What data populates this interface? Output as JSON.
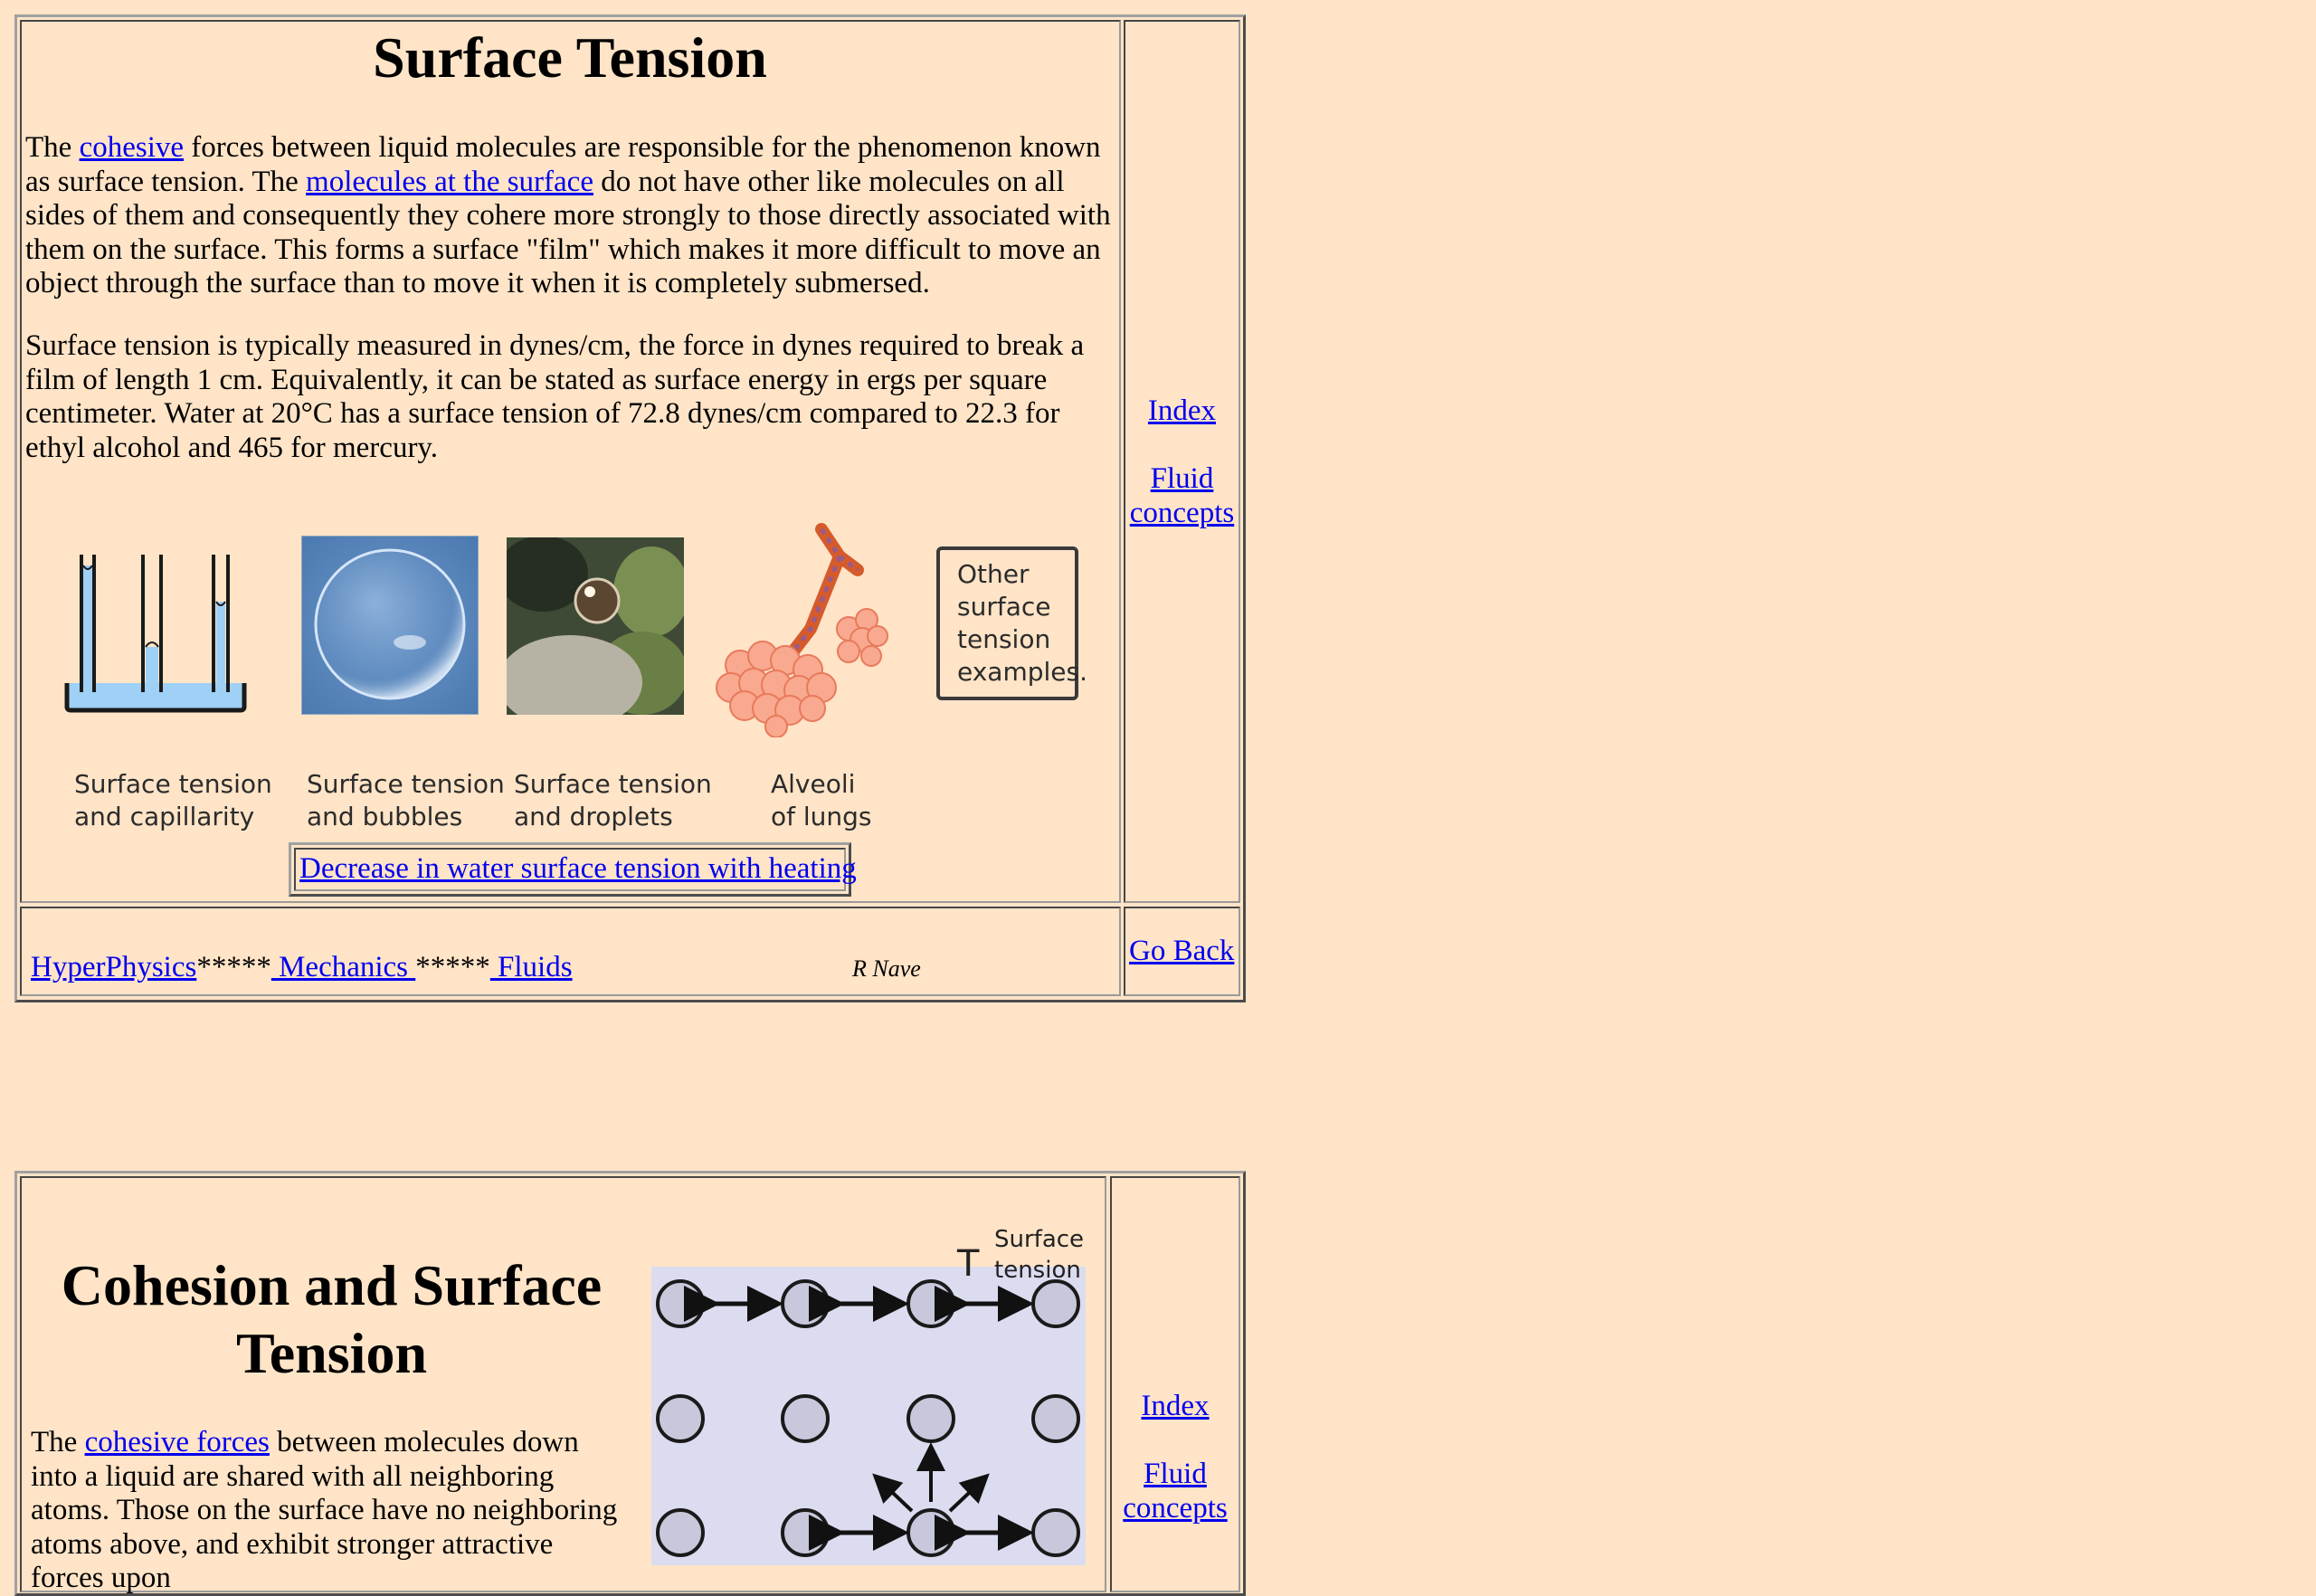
{
  "section1": {
    "title": "Surface Tension",
    "p1": {
      "t1": "The ",
      "link1": "cohesive",
      "t2": " forces between liquid molecules are responsible for the phenomenon known as surface tension. The ",
      "link2": "molecules at the surface",
      "t3": " do not have other like molecules on all sides of them and consequently they cohere more strongly to those directly associated with them on the surface. This forms a surface \"film\" which makes it more difficult to move an object through the surface than to move it when it is completely submersed."
    },
    "p2": "Surface tension is typically measured in dynes/cm, the force in dynes required to break a film of length 1 cm. Equivalently, it can be stated as surface energy in ergs per square centimeter. Water at 20°C has a surface tension of 72.8 dynes/cm compared to 22.3 for ethyl alcohol and 465 for mercury.",
    "captions": {
      "capillarity": "Surface tension\nand capillarity",
      "bubbles": "Surface tension\nand bubbles",
      "droplets": "Surface tension\nand droplets",
      "alveoli": "Alveoli\nof lungs"
    },
    "other_box": "Other\nsurface\ntension\nexamples.",
    "heating_link": "Decrease in water surface tension with heating",
    "side": {
      "index": "Index",
      "fluid": "Fluid concepts"
    },
    "footer": {
      "hyperphysics": "HyperPhysics",
      "stars1": "*****",
      "mechanics": " Mechanics ",
      "stars2": "*****",
      "fluids": " Fluids",
      "author": "R Nave",
      "go_back": "Go Back"
    }
  },
  "section2": {
    "title": "Cohesion and Surface Tension",
    "p1": {
      "t1": "The ",
      "link": "cohesive forces",
      "t2": " between molecules down into a liquid are shared with all neighboring atoms. Those on the surface have no neighboring atoms above, and exhibit stronger attractive forces upon"
    },
    "diagram": {
      "t_symbol": "T",
      "label": "Surface\ntension"
    },
    "side": {
      "index": "Index",
      "fluid": "Fluid concepts"
    }
  },
  "colors": {
    "background": "#ffe4c7",
    "link": "#0000ee",
    "water": "#9fd0f5",
    "diagram_fill": "#dcdcf0",
    "molecule": "#c8c8dc",
    "alveoli": "#f9a98f"
  }
}
